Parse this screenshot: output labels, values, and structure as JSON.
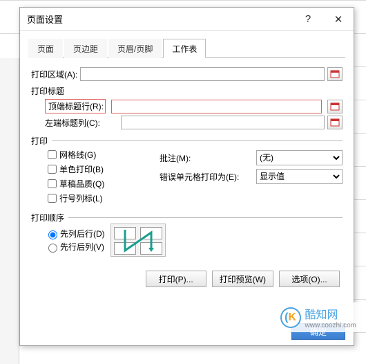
{
  "dialog": {
    "title": "页面设置",
    "help_icon": "?",
    "close_icon": "✕"
  },
  "tabs": [
    "页面",
    "页边距",
    "页眉/页脚",
    "工作表"
  ],
  "active_tab": 3,
  "print_area": {
    "label": "打印区域(A):",
    "value": ""
  },
  "print_titles": {
    "group": "打印标题",
    "top_row": {
      "label": "顶端标题行(R):",
      "value": ""
    },
    "left_col": {
      "label": "左端标题列(C):",
      "value": ""
    }
  },
  "print": {
    "group": "打印",
    "gridlines": "网格线(G)",
    "black_white": "单色打印(B)",
    "draft": "草稿品质(Q)",
    "row_col_headings": "行号列标(L)",
    "comments_label": "批注(M):",
    "comments_value": "(无)",
    "errors_label": "错误单元格打印为(E):",
    "errors_value": "显示值"
  },
  "order": {
    "group": "打印顺序",
    "down_over": "先列后行(D)",
    "over_down": "先行后列(V)"
  },
  "buttons": {
    "print": "打印(P)...",
    "preview": "打印预览(W)",
    "options": "选项(O)...",
    "ok": "确定"
  },
  "watermark": {
    "brand": "酷知网",
    "domain": "www.coozhi.com"
  }
}
